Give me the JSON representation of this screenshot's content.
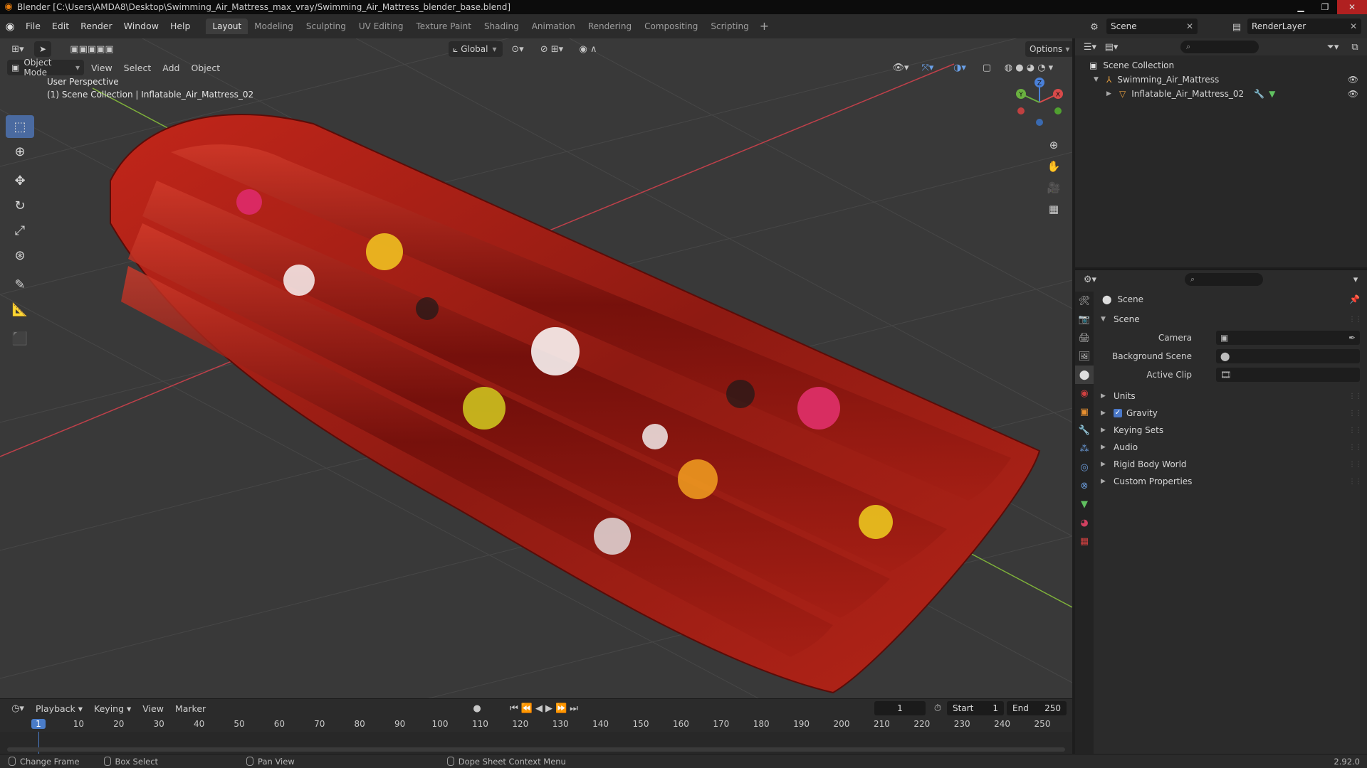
{
  "window": {
    "title": "Blender [C:\\Users\\AMDA8\\Desktop\\Swimming_Air_Mattress_max_vray/Swimming_Air_Mattress_blender_base.blend]"
  },
  "menu": {
    "items": [
      "File",
      "Edit",
      "Render",
      "Window",
      "Help"
    ]
  },
  "workspaces": {
    "tabs": [
      "Layout",
      "Modeling",
      "Sculpting",
      "UV Editing",
      "Texture Paint",
      "Shading",
      "Animation",
      "Rendering",
      "Compositing",
      "Scripting"
    ],
    "active": "Layout",
    "add": "+"
  },
  "scene_selector": {
    "value": "Scene"
  },
  "layer_selector": {
    "value": "RenderLayer"
  },
  "viewport": {
    "mode": "Object Mode",
    "menus": [
      "View",
      "Select",
      "Add",
      "Object"
    ],
    "transform_orientation": "Global",
    "options_label": "Options",
    "perspective_label": "User Perspective",
    "collection_label": "(1) Scene Collection | Inflatable_Air_Mattress_02",
    "gizmo_axes": {
      "x": "X",
      "y": "Y",
      "z": "Z"
    },
    "colors": {
      "background": "#393939",
      "grid": "#474747",
      "x_axis": "#c0404a",
      "y_axis": "#7fb23a",
      "mattress": "#9b1d14"
    }
  },
  "timeline": {
    "menus": [
      "Playback",
      "Keying",
      "View",
      "Marker"
    ],
    "current_frame": "1",
    "start_label": "Start",
    "start_value": "1",
    "end_label": "End",
    "end_value": "250",
    "ruler": [
      "1",
      "10",
      "20",
      "30",
      "40",
      "50",
      "60",
      "70",
      "80",
      "90",
      "100",
      "110",
      "120",
      "130",
      "140",
      "150",
      "160",
      "170",
      "180",
      "190",
      "200",
      "210",
      "220",
      "230",
      "240",
      "250"
    ]
  },
  "status": {
    "items": [
      "Change Frame",
      "Box Select",
      "Pan View",
      "Dope Sheet Context Menu"
    ],
    "version": "2.92.0"
  },
  "outliner": {
    "root": "Scene Collection",
    "collection": "Swimming_Air_Mattress",
    "object": "Inflatable_Air_Mattress_02"
  },
  "properties": {
    "context": "Scene",
    "panel": "Scene",
    "fields": [
      {
        "label": "Camera",
        "value": ""
      },
      {
        "label": "Background Scene",
        "value": ""
      },
      {
        "label": "Active Clip",
        "value": ""
      }
    ],
    "subpanels": [
      "Units",
      "Gravity",
      "Keying Sets",
      "Audio",
      "Rigid Body World",
      "Custom Properties"
    ],
    "gravity_checked": true
  }
}
